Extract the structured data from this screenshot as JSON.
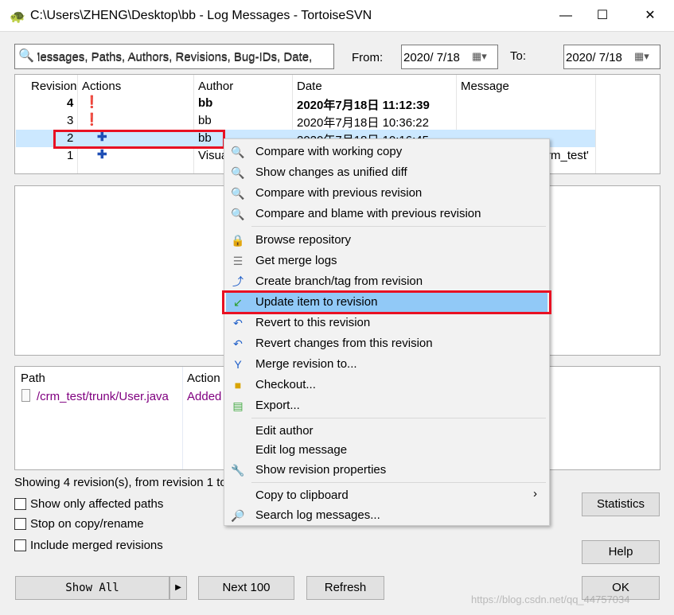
{
  "window": {
    "title": "C:\\Users\\ZHENG\\Desktop\\bb - Log Messages - TortoiseSVN",
    "minimize": "—",
    "maximize": "☐",
    "close": "✕"
  },
  "filter": {
    "placeholder": "Messages, Paths, Authors, Revisions, Bug-IDs, Date,",
    "shown_text": "lessages, Paths, Authors, Revisions, Bug-IDs, Date,",
    "from_label": "From:",
    "from_date": "2020/  7/18",
    "to_label": "To:",
    "to_date": "2020/  7/18"
  },
  "log": {
    "columns": [
      "Revision",
      "Actions",
      "Author",
      "Date",
      "Message"
    ],
    "rows": [
      {
        "revision": "4",
        "author": "bb",
        "date": "2020年7月18日 11:12:39",
        "message": "",
        "action_icon": "modified-icon",
        "bold": true
      },
      {
        "revision": "3",
        "author": "bb",
        "date": "2020年7月18日 10:36:22",
        "message": "",
        "action_icon": "modified-icon"
      },
      {
        "revision": "2",
        "author": "bb",
        "date": "2020年7月18日 10:16:45",
        "message": "",
        "action_icon": "added-icon",
        "selected": true
      },
      {
        "revision": "1",
        "author": "Visua",
        "date": "",
        "message": "rm_test'",
        "action_icon": "added-icon"
      }
    ]
  },
  "paths": {
    "columns": [
      "Path",
      "Action"
    ],
    "rows": [
      {
        "path": "/crm_test/trunk/User.java",
        "action": "Added"
      }
    ]
  },
  "status": "Showing 4 revision(s), from revision 1 to",
  "options": [
    "Show only affected paths",
    "Stop on copy/rename",
    "Include merged revisions"
  ],
  "buttons": {
    "show_all": "Show All",
    "next": "Next 100",
    "refresh": "Refresh",
    "statistics": "Statistics",
    "help": "Help",
    "ok": "OK"
  },
  "context_menu": {
    "items": [
      {
        "label": "Compare with working copy",
        "icon": "magnifier-icon"
      },
      {
        "label": "Show changes as unified diff",
        "icon": "magnifier-icon"
      },
      {
        "label": "Compare with previous revision",
        "icon": "magnifier-icon"
      },
      {
        "label": "Compare and blame with previous revision",
        "icon": "blame-icon"
      },
      {
        "label": "Browse repository",
        "icon": "repo-browser-icon"
      },
      {
        "label": "Get merge logs",
        "icon": "merge-logs-icon"
      },
      {
        "label": "Create branch/tag from revision",
        "icon": "branch-icon"
      },
      {
        "label": "Update item to revision",
        "icon": "update-icon",
        "highlighted": true
      },
      {
        "label": "Revert to this revision",
        "icon": "revert-icon"
      },
      {
        "label": "Revert changes from this revision",
        "icon": "revert-icon"
      },
      {
        "label": "Merge revision to...",
        "icon": "merge-icon"
      },
      {
        "label": "Checkout...",
        "icon": "checkout-icon"
      },
      {
        "label": "Export...",
        "icon": "export-icon"
      },
      {
        "label": "Edit author",
        "icon": ""
      },
      {
        "label": "Edit log message",
        "icon": ""
      },
      {
        "label": "Show revision properties",
        "icon": "wrench-icon"
      },
      {
        "label": "Copy to clipboard",
        "icon": "",
        "submenu": "›"
      },
      {
        "label": "Search log messages...",
        "icon": "search-icon"
      }
    ]
  },
  "watermark": "https://blog.csdn.net/qq_44757034",
  "colors": {
    "selection": "#cce8ff",
    "menu_highlight": "#91c9f7",
    "annotation": "#e81123",
    "path_text": "#800080"
  }
}
